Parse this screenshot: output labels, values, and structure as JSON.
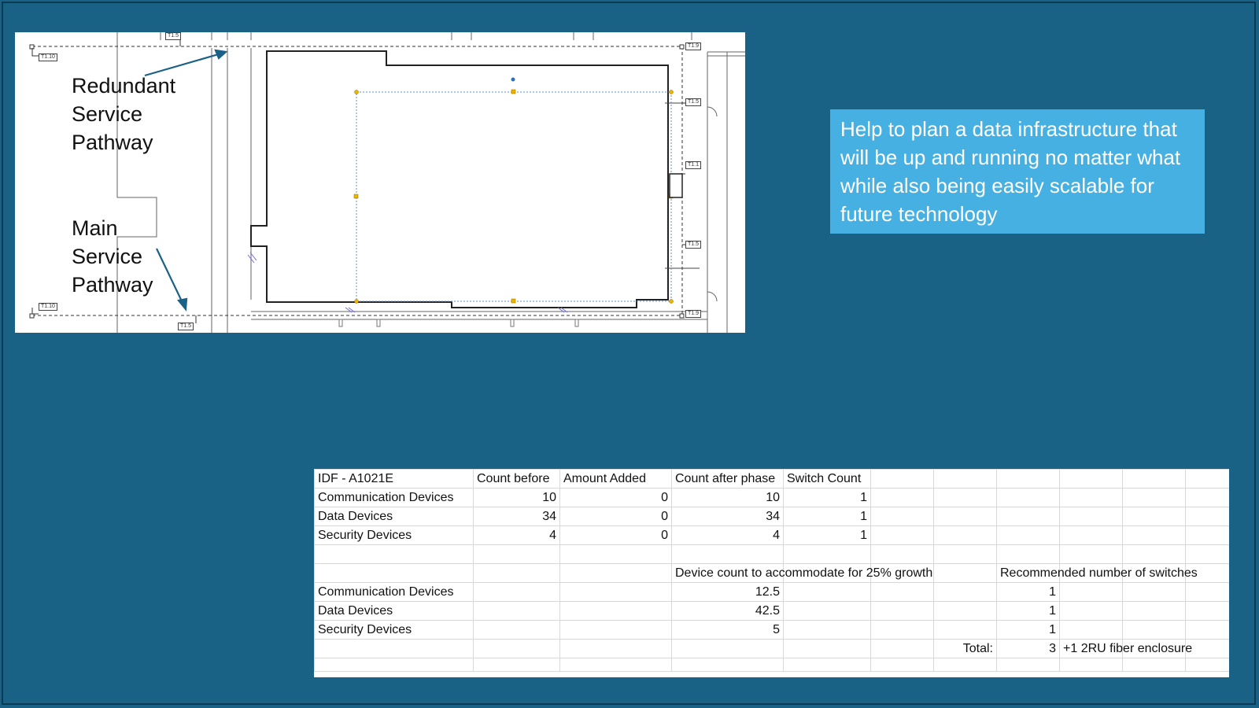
{
  "floor_plan": {
    "labels": {
      "redundant": "Redundant\nService\nPathway",
      "main": "Main\nService\nPathway"
    },
    "tags": {
      "t15_top": "T1.5",
      "t110_top": "T1.10",
      "t19_top": "T1.9",
      "t15_right_top": "T1.5",
      "t11_right": "T1.1",
      "t15_right_bottom": "T1.5",
      "t110_bottom": "T1.10",
      "t15_bottom": "T1.5",
      "t19_bottom": "T1.9"
    }
  },
  "callout": {
    "text": "Help to plan a data infrastructure that will be up and running no matter what while also being easily scalable for future technology"
  },
  "table": {
    "header": [
      "IDF - A1021E",
      "Count before",
      "Amount Added",
      "Count after phase",
      "Switch Count"
    ],
    "rows": [
      [
        "Communication Devices",
        "10",
        "0",
        "10",
        "1"
      ],
      [
        "Data Devices",
        "34",
        "0",
        "34",
        "1"
      ],
      [
        "Security Devices",
        "4",
        "0",
        "4",
        "1"
      ]
    ],
    "growth_header": "Device count to accommodate for 25% growth",
    "recommend_header": "Recommended number of switches",
    "growth_rows": [
      [
        "Communication Devices",
        "12.5",
        "1"
      ],
      [
        "Data Devices",
        "42.5",
        "1"
      ],
      [
        "Security Devices",
        "5",
        "1"
      ]
    ],
    "total_label": "Total:",
    "total_value": "3",
    "total_note": "+1 2RU fiber enclosure"
  },
  "colors": {
    "background": "#1a6186",
    "callout": "#47b0e2",
    "arrow": "#1a6186",
    "handle_yellow": "#f0b400",
    "handle_blue": "#2f6fb5"
  }
}
